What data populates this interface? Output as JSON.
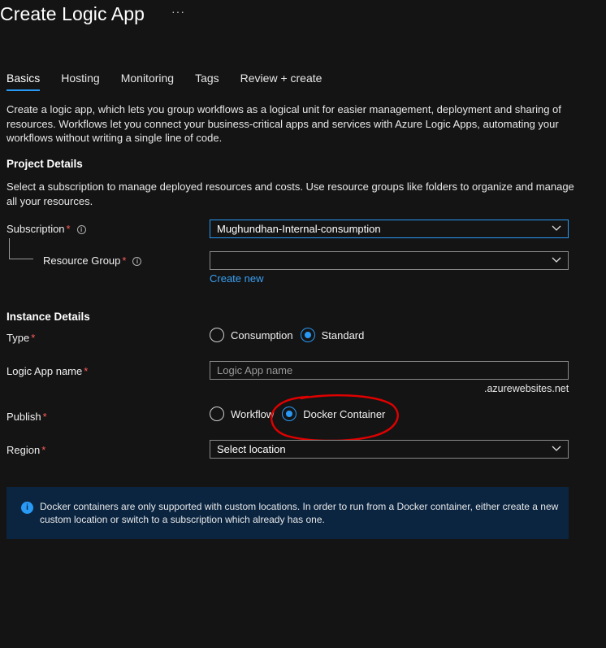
{
  "header": {
    "title": "Create Logic App",
    "more": "···"
  },
  "tabs": [
    {
      "label": "Basics",
      "active": true
    },
    {
      "label": "Hosting",
      "active": false
    },
    {
      "label": "Monitoring",
      "active": false
    },
    {
      "label": "Tags",
      "active": false
    },
    {
      "label": "Review + create",
      "active": false
    }
  ],
  "description": "Create a logic app, which lets you group workflows as a logical unit for easier management, deployment and sharing of resources. Workflows let you connect your business-critical apps and services with Azure Logic Apps, automating your workflows without writing a single line of code.",
  "project": {
    "heading": "Project Details",
    "text": "Select a subscription to manage deployed resources and costs. Use resource groups like folders to organize and manage all your resources.",
    "subscription_label": "Subscription",
    "subscription_value": "Mughundhan-Internal-consumption",
    "resource_group_label": "Resource Group",
    "resource_group_value": "",
    "create_new": "Create new"
  },
  "instance": {
    "heading": "Instance Details",
    "type_label": "Type",
    "type_options": [
      "Consumption",
      "Standard"
    ],
    "type_selected": "Standard",
    "name_label": "Logic App name",
    "name_placeholder": "Logic App name",
    "name_suffix": ".azurewebsites.net",
    "publish_label": "Publish",
    "publish_options": [
      "Workflow",
      "Docker Container"
    ],
    "publish_selected": "Docker Container",
    "region_label": "Region",
    "region_value": "Select location"
  },
  "required_mark": "*",
  "info_banner": {
    "text": "Docker containers are only supported with custom locations. In order to run from a Docker container, either create a new custom location or switch to a subscription which already has one."
  },
  "colors": {
    "background": "#141414",
    "accent": "#2899f5",
    "required": "#ff5b5b",
    "banner": "#0b2541",
    "annotation": "#e00000"
  }
}
